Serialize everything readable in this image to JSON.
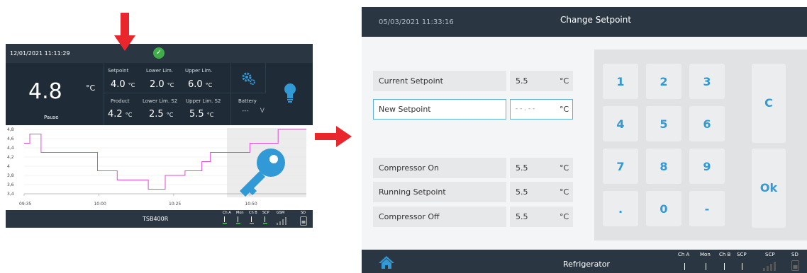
{
  "left_screen": {
    "datetime": "12/01/2021 11:11:29",
    "status_icon": "check-circle-icon",
    "main_value": "4.8",
    "main_unit": "°C",
    "main_status": "Pause",
    "readings": [
      {
        "label": "Setpoint",
        "value": "4.0",
        "unit": "°C"
      },
      {
        "label": "Lower Lim.",
        "value": "2.0",
        "unit": "°C"
      },
      {
        "label": "Upper Lim.",
        "value": "6.0",
        "unit": "°C"
      },
      {
        "label": "Product",
        "value": "4.2",
        "unit": "°C"
      },
      {
        "label": "Lower Lim. S2",
        "value": "2.5",
        "unit": "°C"
      },
      {
        "label": "Upper Lim. S2",
        "value": "5.5",
        "unit": "°C"
      },
      {
        "label": "Battery",
        "value": "---",
        "unit": "V"
      }
    ],
    "chart_data": {
      "type": "line",
      "y_ticks": [
        "4,8",
        "4,6",
        "4,4",
        "4,2",
        "4",
        "3,8",
        "3,6",
        "3,4"
      ],
      "x_ticks": [
        "09:35",
        "10:00",
        "10:25",
        "10:50"
      ],
      "ylim": [
        3.4,
        4.8
      ],
      "series": [
        {
          "color": "#e04bd6",
          "points": [
            [
              0,
              4.5
            ],
            [
              0.02,
              4.5
            ],
            [
              0.02,
              4.7
            ],
            [
              0.06,
              4.7
            ],
            [
              0.06,
              4.3
            ],
            [
              0.26,
              4.3
            ],
            [
              0.26,
              3.9
            ],
            [
              0.33,
              3.9
            ],
            [
              0.33,
              3.7
            ],
            [
              0.44,
              3.7
            ],
            [
              0.44,
              3.5
            ],
            [
              0.5,
              3.5
            ],
            [
              0.5,
              3.8
            ],
            [
              0.57,
              3.8
            ],
            [
              0.57,
              3.9
            ],
            [
              0.63,
              3.9
            ],
            [
              0.63,
              4.1
            ],
            [
              0.66,
              4.1
            ],
            [
              0.66,
              4.3
            ],
            [
              0.8,
              4.3
            ],
            [
              0.8,
              4.5
            ],
            [
              0.9,
              4.5
            ],
            [
              0.9,
              4.8
            ],
            [
              1.0,
              4.8
            ]
          ]
        }
      ]
    },
    "device_name": "TSB400R",
    "footer_channels": [
      "Ch A",
      "Mon",
      "Ch B",
      "SCP",
      "GSM",
      "SD"
    ]
  },
  "right_screen": {
    "datetime": "05/03/2021 11:33:16",
    "title": "Change Setpoint",
    "rows": [
      {
        "label": "Current Setpoint",
        "value": "5.5",
        "unit": "°C"
      },
      {
        "label": "New Setpoint",
        "value": "- - . - -",
        "unit": "°C"
      },
      {
        "label": "Compressor On",
        "value": "5.5",
        "unit": "°C"
      },
      {
        "label": "Running Setpoint",
        "value": "5.5",
        "unit": "°C"
      },
      {
        "label": "Compressor Off",
        "value": "5.5",
        "unit": "°C"
      }
    ],
    "keys": [
      "1",
      "2",
      "3",
      "4",
      "5",
      "6",
      "7",
      "8",
      "9",
      ".",
      "0",
      "-"
    ],
    "clear_key": "C",
    "ok_key": "Ok",
    "footer_title": "Refrigerator",
    "footer_channels": [
      "Ch A",
      "Mon",
      "Ch B",
      "SCP",
      "SCP",
      "SD"
    ],
    "home_icon": "home-icon"
  },
  "colors": {
    "header": "#2a3743",
    "panel": "#2c3e4c",
    "accent_blue": "#3199d6",
    "arrow_red": "#e8262b",
    "ok_green": "#3fae49",
    "chart_line": "#e04bd6"
  }
}
